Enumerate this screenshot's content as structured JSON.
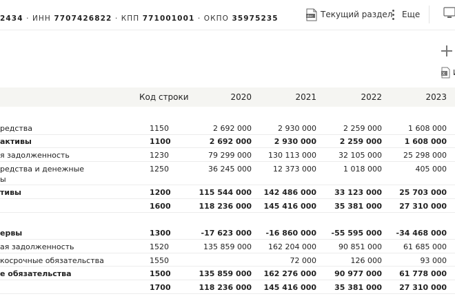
{
  "header": {
    "codes": [
      {
        "label": "",
        "value": "2434"
      },
      {
        "label": "ИНН",
        "value": "7707426822"
      },
      {
        "label": "КПП",
        "value": "771001001"
      },
      {
        "label": "ОКПО",
        "value": "35975235"
      }
    ],
    "section_button_label": "Текущий раздел",
    "more_button_label": "Еще",
    "excel_button_label": "И"
  },
  "table": {
    "headers": {
      "code": "Код строки",
      "y2020": "2020",
      "y2021": "2021",
      "y2022": "2022",
      "y2023": "2023"
    },
    "rows": [
      {
        "label": "редства",
        "code": "1150",
        "v": [
          "2 692 000",
          "2 930 000",
          "2 259 000",
          "1 608 000"
        ],
        "bold": false
      },
      {
        "label": "активы",
        "code": "1100",
        "v": [
          "2 692 000",
          "2 930 000",
          "2 259 000",
          "1 608 000"
        ],
        "bold": true
      },
      {
        "label": "я задолженность",
        "code": "1230",
        "v": [
          "79 299 000",
          "130 113 000",
          "32 105 000",
          "25 298 000"
        ],
        "bold": false
      },
      {
        "label": "редства и денежные",
        "label2": "ы",
        "code": "1250",
        "v": [
          "36 245 000",
          "12 373 000",
          "1 018 000",
          "405 000"
        ],
        "bold": false
      },
      {
        "label": "тивы",
        "code": "1200",
        "v": [
          "115 544 000",
          "142 486 000",
          "33 123 000",
          "25 703 000"
        ],
        "bold": true
      },
      {
        "label": "",
        "code": "1600",
        "v": [
          "118 236 000",
          "145 416 000",
          "35 381 000",
          "27 310 000"
        ],
        "bold": true
      },
      {
        "label": "ервы",
        "code": "1300",
        "v": [
          "-17 623 000",
          "-16 860 000",
          "-55 595 000",
          "-34 468 000"
        ],
        "bold": true
      },
      {
        "label": "ая задолженность",
        "code": "1520",
        "v": [
          "135 859 000",
          "162 204 000",
          "90 851 000",
          "61 685 000"
        ],
        "bold": false
      },
      {
        "label": "косрочные обязательства",
        "code": "1550",
        "v": [
          "",
          "72 000",
          "126 000",
          "93 000"
        ],
        "bold": false
      },
      {
        "label": "е обязательства",
        "code": "1500",
        "v": [
          "135 859 000",
          "162 276 000",
          "90 977 000",
          "61 778 000"
        ],
        "bold": true
      },
      {
        "label": "",
        "code": "1700",
        "v": [
          "118 236 000",
          "145 416 000",
          "35 381 000",
          "27 310 000"
        ],
        "bold": true
      }
    ]
  }
}
